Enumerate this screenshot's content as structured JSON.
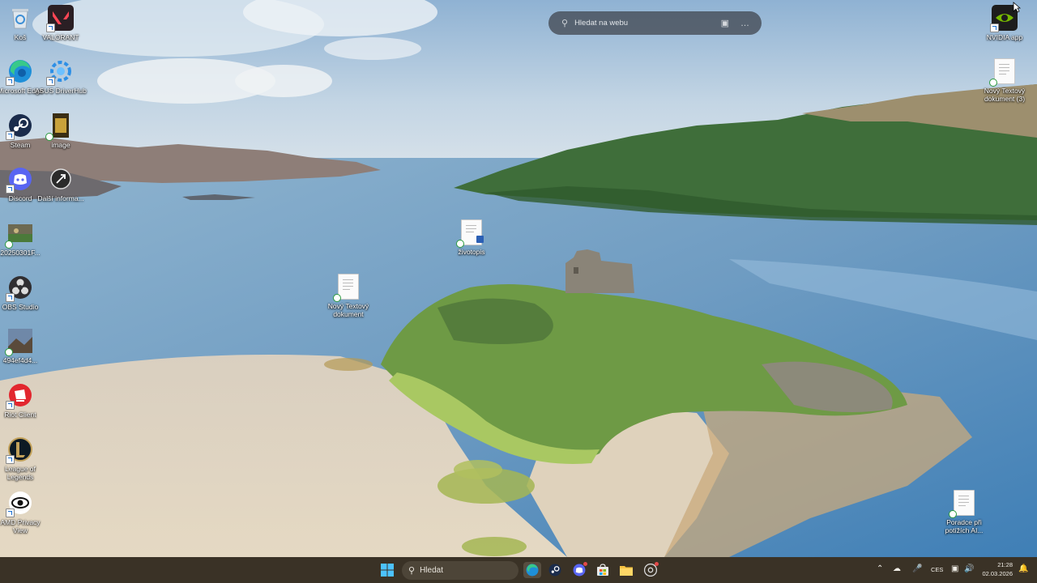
{
  "desktop": {
    "left_column": [
      {
        "label": "Koš",
        "icon": "recycle-bin-icon"
      },
      {
        "label": "VALORANT",
        "icon": "valorant-icon"
      },
      {
        "label": "Microsoft Edge",
        "icon": "edge-icon"
      },
      {
        "label": "ASUS DriverHub",
        "icon": "asus-driverhub-icon"
      },
      {
        "label": "Steam",
        "icon": "steam-icon"
      },
      {
        "label": "image",
        "icon": "image-file-icon"
      },
      {
        "label": "Discord",
        "icon": "discord-icon"
      },
      {
        "label": "Další informa...",
        "icon": "info-shortcut-icon"
      },
      {
        "label": "20250301F...",
        "icon": "photo-file-icon"
      },
      {
        "label": "OBS Studio",
        "icon": "obs-icon"
      },
      {
        "label": "494ef4d4...",
        "icon": "image-thumb-icon"
      },
      {
        "label": "Riot Client",
        "icon": "riot-client-icon"
      },
      {
        "label": "League of Legends",
        "icon": "league-of-legends-icon"
      },
      {
        "label": "AMD Privacy View",
        "icon": "amd-privacy-view-icon"
      }
    ],
    "middle": [
      {
        "label": "životopis",
        "icon": "word-document-icon"
      },
      {
        "label": "Nový Textový dokument",
        "icon": "text-document-icon"
      }
    ],
    "right_column": [
      {
        "label": "NVIDIA app",
        "icon": "nvidia-icon"
      },
      {
        "label": "Nový Textový dokument (3)",
        "icon": "text-document-icon"
      },
      {
        "label": "Poradce při potížích AI...",
        "icon": "text-document-icon"
      }
    ]
  },
  "web_search": {
    "placeholder": "Hledat na webu",
    "icons": [
      "search-icon",
      "visual-search-icon",
      "more-icon"
    ]
  },
  "taskbar": {
    "search_label": "Hledat",
    "apps": [
      "start-icon",
      "edge-icon",
      "steam-icon",
      "discord-icon",
      "store-icon",
      "file-explorer-icon",
      "chrome-icon"
    ],
    "tray": {
      "language": "CES",
      "time": "21:28",
      "date": "02.03.2026"
    }
  },
  "colors": {
    "taskbar": "#3a3226",
    "search_pill": "#3c4048"
  }
}
